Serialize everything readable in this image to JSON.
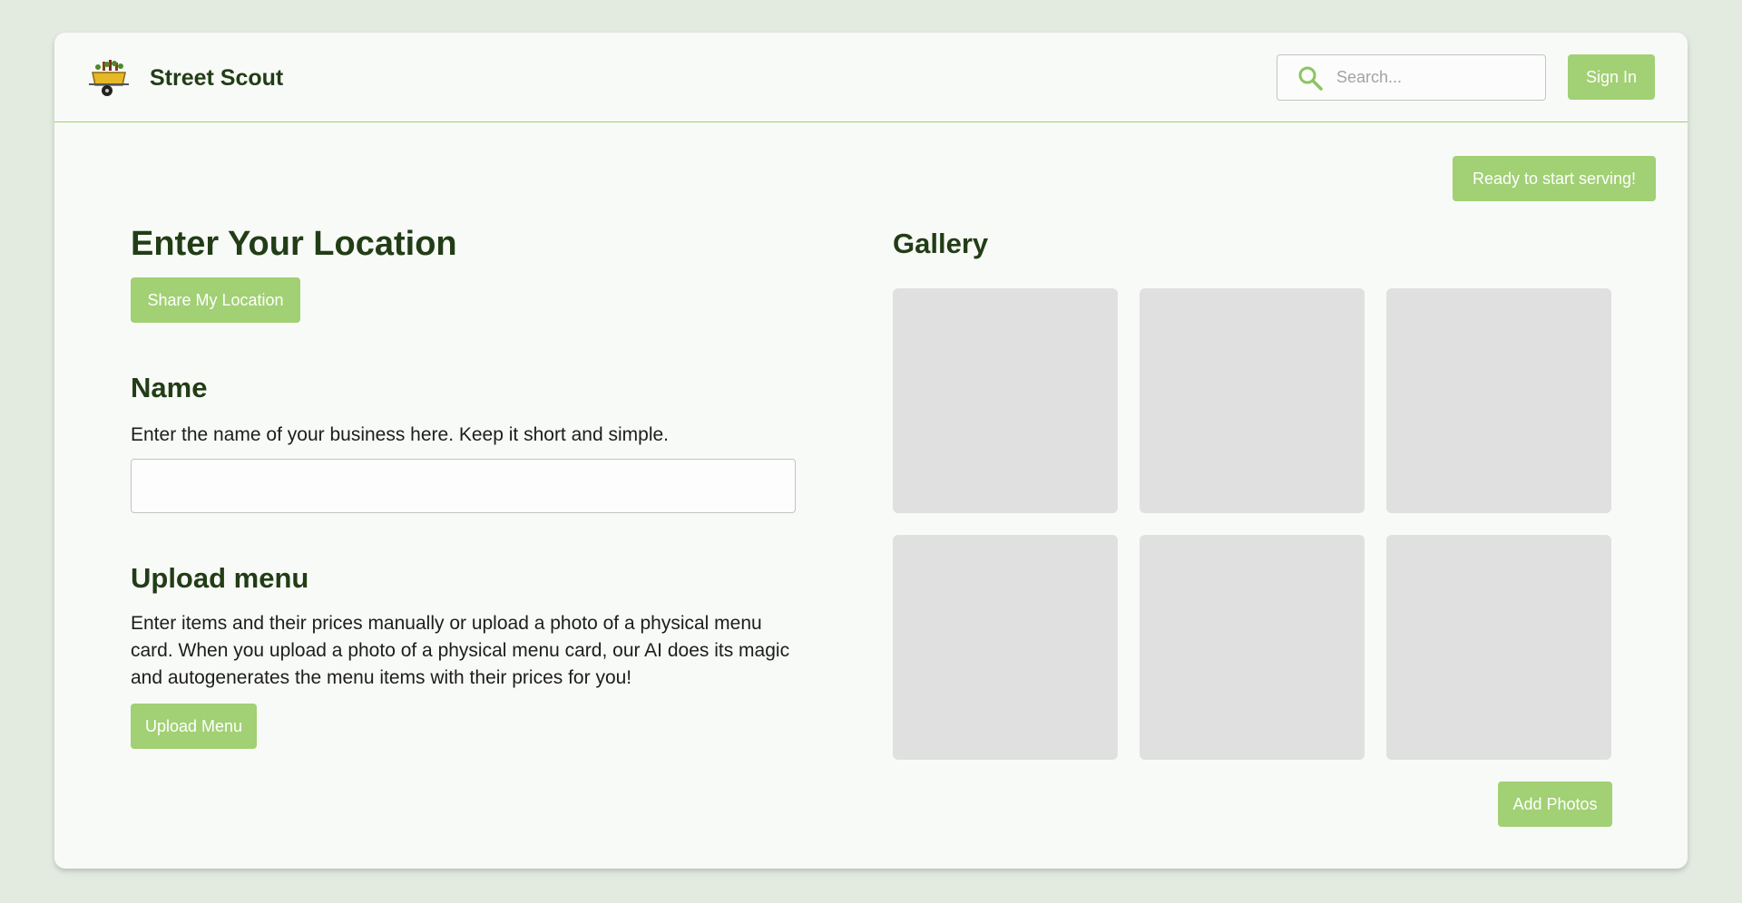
{
  "header": {
    "brand": "Street Scout",
    "search_placeholder": "Search...",
    "signin_label": "Sign In"
  },
  "main": {
    "ready_label": "Ready to start serving!",
    "location": {
      "title": "Enter Your Location",
      "share_label": "Share My Location"
    },
    "name": {
      "title": "Name",
      "description": "Enter the name of your business here. Keep it short and simple.",
      "value": ""
    },
    "upload": {
      "title": "Upload menu",
      "description": "Enter items and their prices manually or upload a photo of a physical menu card. When you upload a photo of a physical menu card, our AI does its magic and autogenerates the menu items with their prices for you!",
      "button_label": "Upload Menu"
    },
    "gallery": {
      "title": "Gallery",
      "tiles": [
        "",
        "",
        "",
        "",
        "",
        ""
      ],
      "add_label": "Add Photos"
    }
  },
  "colors": {
    "accent": "#a2d074",
    "heading": "#223d16",
    "background": "#e3ebe1",
    "card": "#f8faf7",
    "tile": "#e0e0e0"
  }
}
